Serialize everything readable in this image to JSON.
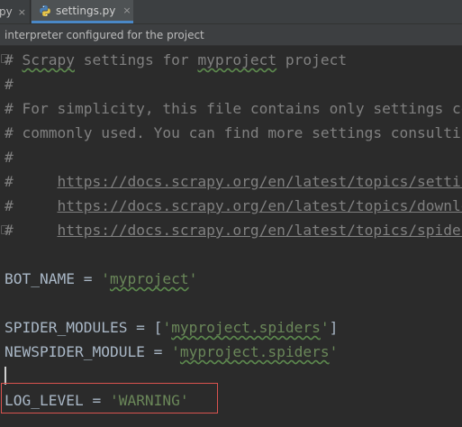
{
  "tabs": {
    "previous": {
      "label": "py",
      "close": "×"
    },
    "active": {
      "label": "settings.py",
      "close": "×"
    }
  },
  "banner": {
    "text": "interpreter configured for the project"
  },
  "code": {
    "l1_hash": "# ",
    "l1_w1": "Scrapy",
    "l1_mid": " settings for ",
    "l1_w2": "myproject",
    "l1_end": " project",
    "l2": "#",
    "l3": "# For simplicity, this file contains only settings considered important or",
    "l4": "# commonly used. You can find more settings consulting the documentation:",
    "l5": "#",
    "l6_hash": "#     ",
    "l6_url": "https://docs.scrapy.org/en/latest/topics/settings.html",
    "l7_hash": "#     ",
    "l7_url": "https://docs.scrapy.org/en/latest/topics/downloader-middleware.html",
    "l8_hash": "#     ",
    "l8_url": "https://docs.scrapy.org/en/latest/topics/spider-middleware.html",
    "l10_name": "BOT_NAME = ",
    "l10_q1": "'",
    "l10_val": "myproject",
    "l10_q2": "'",
    "l12_name": "SPIDER_MODULES = [",
    "l12_q1": "'",
    "l12_val": "myproject.spiders",
    "l12_q2": "'",
    "l12_end": "]",
    "l13_name": "NEWSPIDER_MODULE = ",
    "l13_q1": "'",
    "l13_val": "myproject.spiders",
    "l13_q2": "'",
    "l15_name": "LOG_LEVEL = ",
    "l15_val": "'WARNING'"
  }
}
